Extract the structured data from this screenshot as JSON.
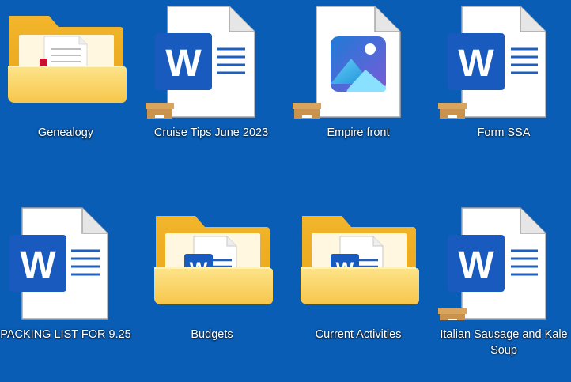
{
  "desktop": {
    "background_color": "#0a5db5",
    "items": [
      {
        "label": "Genealogy",
        "icon": "folder-icon"
      },
      {
        "label": "Cruise Tips  June 2023",
        "icon": "word-document-icon"
      },
      {
        "label": "Empire front",
        "icon": "image-file-icon"
      },
      {
        "label": "Form SSA",
        "icon": "word-document-icon"
      },
      {
        "label": "PACKING LIST FOR 9.25",
        "icon": "word-document-icon"
      },
      {
        "label": "Budgets",
        "icon": "folder-icon"
      },
      {
        "label": "Current Activities",
        "icon": "folder-icon"
      },
      {
        "label": "Italian Sausage and Kale Soup",
        "icon": "word-document-icon"
      }
    ]
  }
}
